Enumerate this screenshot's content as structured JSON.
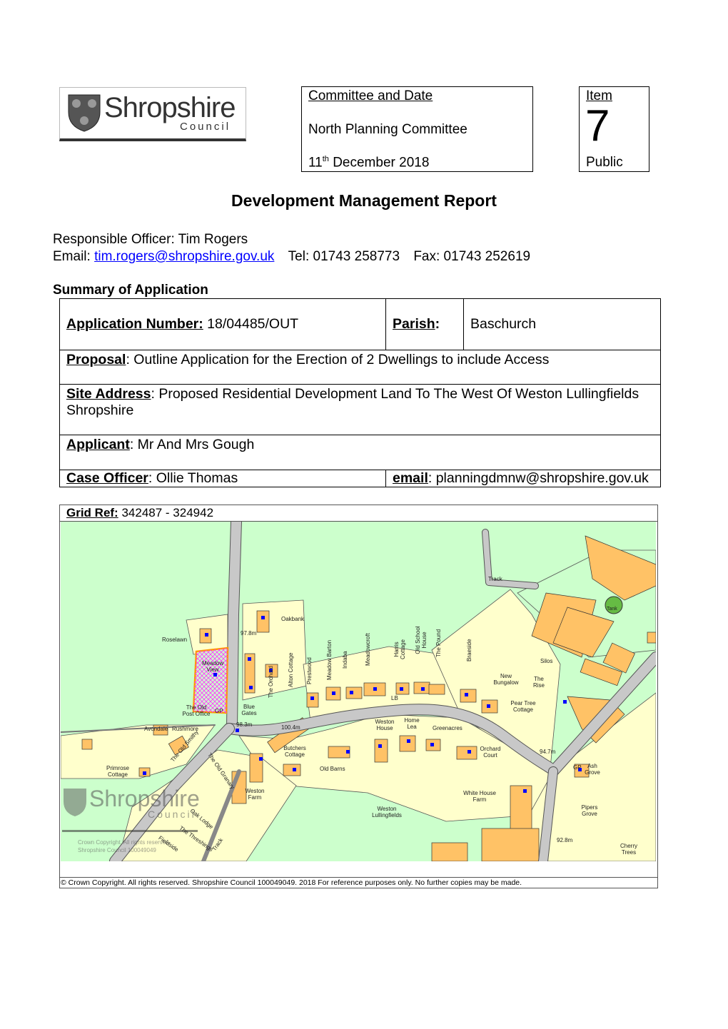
{
  "logo": {
    "wordmark": "Shropshire",
    "sub": "Council"
  },
  "committee": {
    "heading": "Committee and Date",
    "name": "North Planning Committee",
    "date_day": "11",
    "date_suffix": "th",
    "date_rest": " December 2018"
  },
  "item": {
    "heading": "Item",
    "number": "7",
    "status": "Public"
  },
  "title": "Development Management Report",
  "officer": {
    "label": "Responsible Officer: ",
    "name": "Tim Rogers",
    "email_label": "Email: ",
    "email": "tim.rogers@shropshire.gov.uk",
    "tel": "Tel: 01743 258773",
    "fax": "Fax: 01743 252619"
  },
  "summary": {
    "heading": "Summary of Application",
    "application_number_label": "Application Number:",
    "application_number": " 18/04485/OUT",
    "parish_label": "Parish",
    "parish": "Baschurch",
    "proposal_label": "Proposal",
    "proposal": ": Outline Application for the Erection of 2 Dwellings to include Access",
    "site_address_label": "Site Address",
    "site_address": ": Proposed Residential Development Land To The West Of Weston Lullingfields Shropshire",
    "applicant_label": "Applicant",
    "applicant": ": Mr And Mrs Gough",
    "case_officer_label": "Case Officer",
    "case_officer": ": Ollie Thomas",
    "email_label": "email",
    "email": ": planningdmnw@shropshire.gov.uk"
  },
  "map": {
    "grid_ref_label": "Grid Ref:",
    "grid_ref": " 342487 - 324942",
    "colors": {
      "field": "#ccffcc",
      "plot": "#ffffcc",
      "building": "#ffc266",
      "road": "#c8c8c8",
      "site_boundary": "#ff9900",
      "site_hatch": "#ff33ff",
      "point": "#0000ff"
    },
    "labels": [
      "Oakbank",
      "97.8m",
      "Roselawn",
      "Meadow View",
      "The Old Post Office",
      "GP",
      "Blue Gates",
      "98.3m",
      "100.4m",
      "Avondale",
      "Rushmore",
      "Primrose Cottage",
      "Butchers Cottage",
      "Old Barns",
      "Weston Farm",
      "Weston House",
      "Home Lea",
      "Greenacres",
      "Orchard Court",
      "New Bungalow",
      "The Rise",
      "Pear Tree Cottage",
      "Silos",
      "Tank",
      "Track",
      "94.7m",
      "GP",
      "Ash Grove",
      "White House Farm",
      "Weston Lullingfields",
      "Pipers Grove",
      "92.8m",
      "Cherry Trees",
      "LB",
      "The Old Granary",
      "Oak Lodge",
      "The Threshings",
      "Fieldside",
      "Track",
      "The Old Smithy"
    ],
    "vertical_labels": [
      "The Orchard",
      "Alton Cottage",
      "Prestwood",
      "Meadow Barton",
      "Indaba",
      "Meadowcroft",
      "Harris Cottage",
      "Old School House",
      "The Pound",
      "Braeside"
    ],
    "watermark": {
      "wordmark": "Shropshire",
      "sub": "Council",
      "copyright_line1": "Crown Copyright. All rights reserved.",
      "copyright_line2": "Shropshire Council 100049049"
    },
    "footer": "© Crown Copyright. All rights reserved.  Shropshire Council 100049049. 2018  For reference purposes only. No further copies may be made."
  }
}
